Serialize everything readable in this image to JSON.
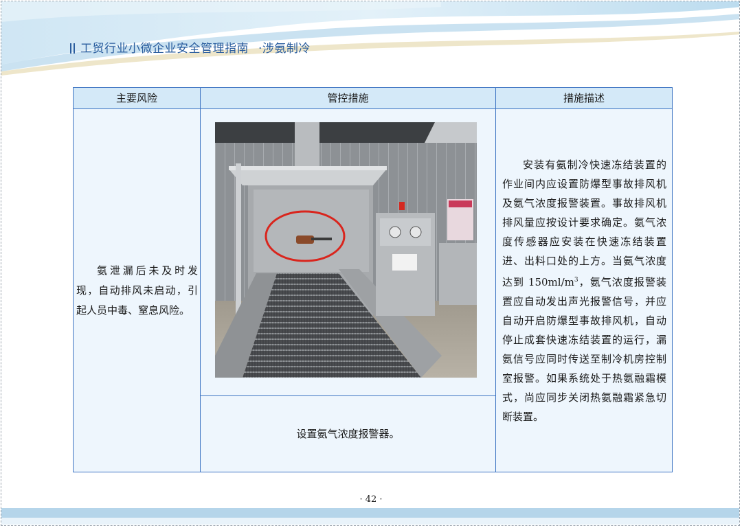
{
  "header": {
    "title": "工贸行业小微企业安全管理指南",
    "subtitle": "·涉氨制冷"
  },
  "table": {
    "headers": [
      "主要风险",
      "管控措施",
      "措施描述"
    ],
    "risk_text": "氨泄漏后未及时发现，自动排风未启动，引起人员中毒、窒息风险。",
    "measure_caption": "设置氨气浓度报警器。",
    "description_pre": "安装有氨制冷快速冻结装置的作业间内应设置防爆型事故排风机及氨气浓度报警装置。事故排风机排风量应按设计要求确定。氨气浓度传感器应安装在快速冻结装置进、出料口处的上方。当氨气浓度达到 150ml/m",
    "description_sup": "3",
    "description_post": "，氨气浓度报警装置应自动发出声光报警信号，并应自动开启防爆型事故排风机，自动停止成套快速冻结装置的运行，漏氨信号应同时传送至制冷机房控制室报警。如果系统处于热氨融霜模式，尚应同步关闭热氨融霜紧急切断装置。"
  },
  "footer": {
    "page_number": "· 42 ·"
  }
}
